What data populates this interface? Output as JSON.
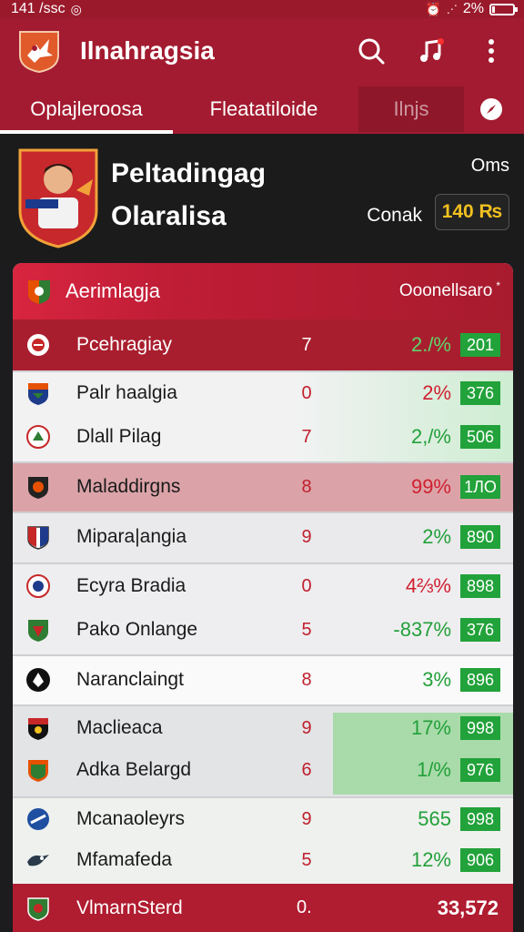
{
  "status_bar": {
    "time": "141 /ssc",
    "signal": "2%"
  },
  "app": {
    "title": "Ilnahragsia"
  },
  "tabs": [
    {
      "label": "Oplajleroosa"
    },
    {
      "label": "Fleatatiloide"
    },
    {
      "label": "Ilnjs"
    }
  ],
  "hero": {
    "name_line1": "Peltadingag",
    "name_line2": "Olaralisa",
    "label_top": "Oms",
    "label_bottom": "Conak",
    "coins": "140 ₨"
  },
  "table": {
    "header_title": "Aerimlagja",
    "header_right": "Ooonellsaro",
    "header_star": "*",
    "rows": [
      {
        "name": "Pcehragiay",
        "num": "7",
        "pct": "2./%",
        "score": "201"
      },
      {
        "name": "Palr haalgia",
        "num": "0",
        "pct": "2%",
        "score": "376"
      },
      {
        "name": "Dlall Pilag",
        "num": "7",
        "pct": "2,/%",
        "score": "506"
      },
      {
        "name": "Maladdirgns",
        "num": "8",
        "pct": "99%",
        "score": "1ЛО"
      },
      {
        "name": "Mipara|angia",
        "num": "9",
        "pct": "2%",
        "score": "890"
      },
      {
        "name": "Ecyra Bradia",
        "num": "0",
        "pct": "4⅔%",
        "score": "898"
      },
      {
        "name": "Pako Onlange",
        "num": "5",
        "pct": "-837%",
        "score": "376"
      },
      {
        "name": "Naranclaingt",
        "num": "8",
        "pct": "3%",
        "score": "896"
      },
      {
        "name": "Maclieaca",
        "num": "9",
        "pct": "17%",
        "score": "998"
      },
      {
        "name": "Adka Belargd",
        "num": "6",
        "pct": "1/%",
        "score": "976"
      },
      {
        "name": "Mcanaoleyrs",
        "num": "9",
        "pct": "565",
        "score": "998"
      },
      {
        "name": "Mfamafeda",
        "num": "5",
        "pct": "12%",
        "score": "906"
      }
    ],
    "footer_name": "VlmarnSterd",
    "footer_num": "0.",
    "footer_total": "33,572"
  },
  "colors": {
    "brand_red": "#a31b30",
    "score_green": "#22a23a",
    "coin_gold": "#f0c020"
  },
  "icons": [
    "club-logo-icon",
    "search-icon",
    "music-notification-icon",
    "more-vert-icon",
    "compass-icon"
  ]
}
